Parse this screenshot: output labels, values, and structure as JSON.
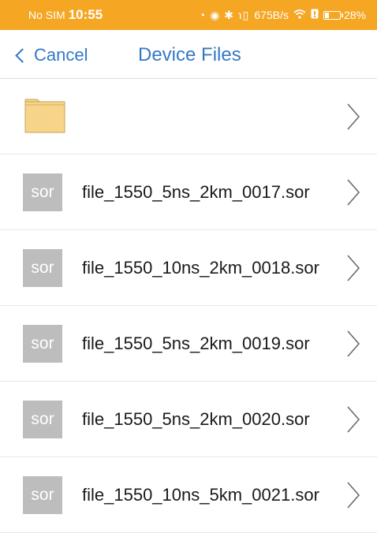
{
  "status_bar": {
    "carrier": "No SIM",
    "time": "10:55",
    "icons": "◔ ◉ ✱ ℩▯",
    "network_speed": "675B/s",
    "battery_percent": "28%",
    "battery_level": 0.28
  },
  "nav": {
    "cancel_label": "Cancel",
    "title": "Device Files"
  },
  "files": [
    {
      "type": "folder",
      "name": ""
    },
    {
      "type": "sor",
      "badge": "sor",
      "name": "file_1550_5ns_2km_0017.sor"
    },
    {
      "type": "sor",
      "badge": "sor",
      "name": "file_1550_10ns_2km_0018.sor"
    },
    {
      "type": "sor",
      "badge": "sor",
      "name": "file_1550_5ns_2km_0019.sor"
    },
    {
      "type": "sor",
      "badge": "sor",
      "name": "file_1550_5ns_2km_0020.sor"
    },
    {
      "type": "sor",
      "badge": "sor",
      "name": "file_1550_10ns_5km_0021.sor"
    }
  ],
  "colors": {
    "status_bar": "#f5a623",
    "accent": "#3478c6",
    "folder": "#f6d48a",
    "sor_badge": "#bdbdbd"
  }
}
